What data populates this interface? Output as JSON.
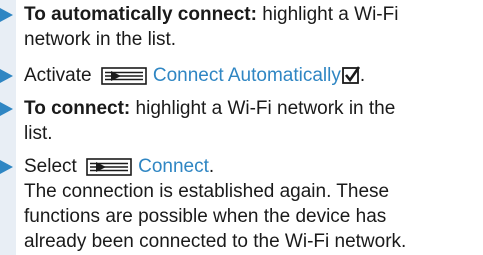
{
  "steps": [
    {
      "bold": "To automatically connect:",
      "text_line1": " highlight a Wi-Fi",
      "text_line2": "network in the list."
    },
    {
      "prefix": "Activate ",
      "action": "Connect Automatically",
      "suffix": "."
    },
    {
      "bold": "To connect:",
      "text_line1": " highlight a Wi-Fi network in the",
      "text_line2": "list."
    },
    {
      "prefix": "Select ",
      "action": "Connect",
      "suffix": ".",
      "result_lines": [
        "The connection is established again. These",
        "functions are possible when the device has",
        "already been connected to the Wi-Fi network."
      ]
    }
  ],
  "icons": {
    "step_marker": "triangle-arrow-icon",
    "menu": "menu-button-icon",
    "checkbox": "checkbox-checked-icon"
  },
  "colors": {
    "accent": "#2f86c3",
    "sidebar": "#e8eef5"
  }
}
